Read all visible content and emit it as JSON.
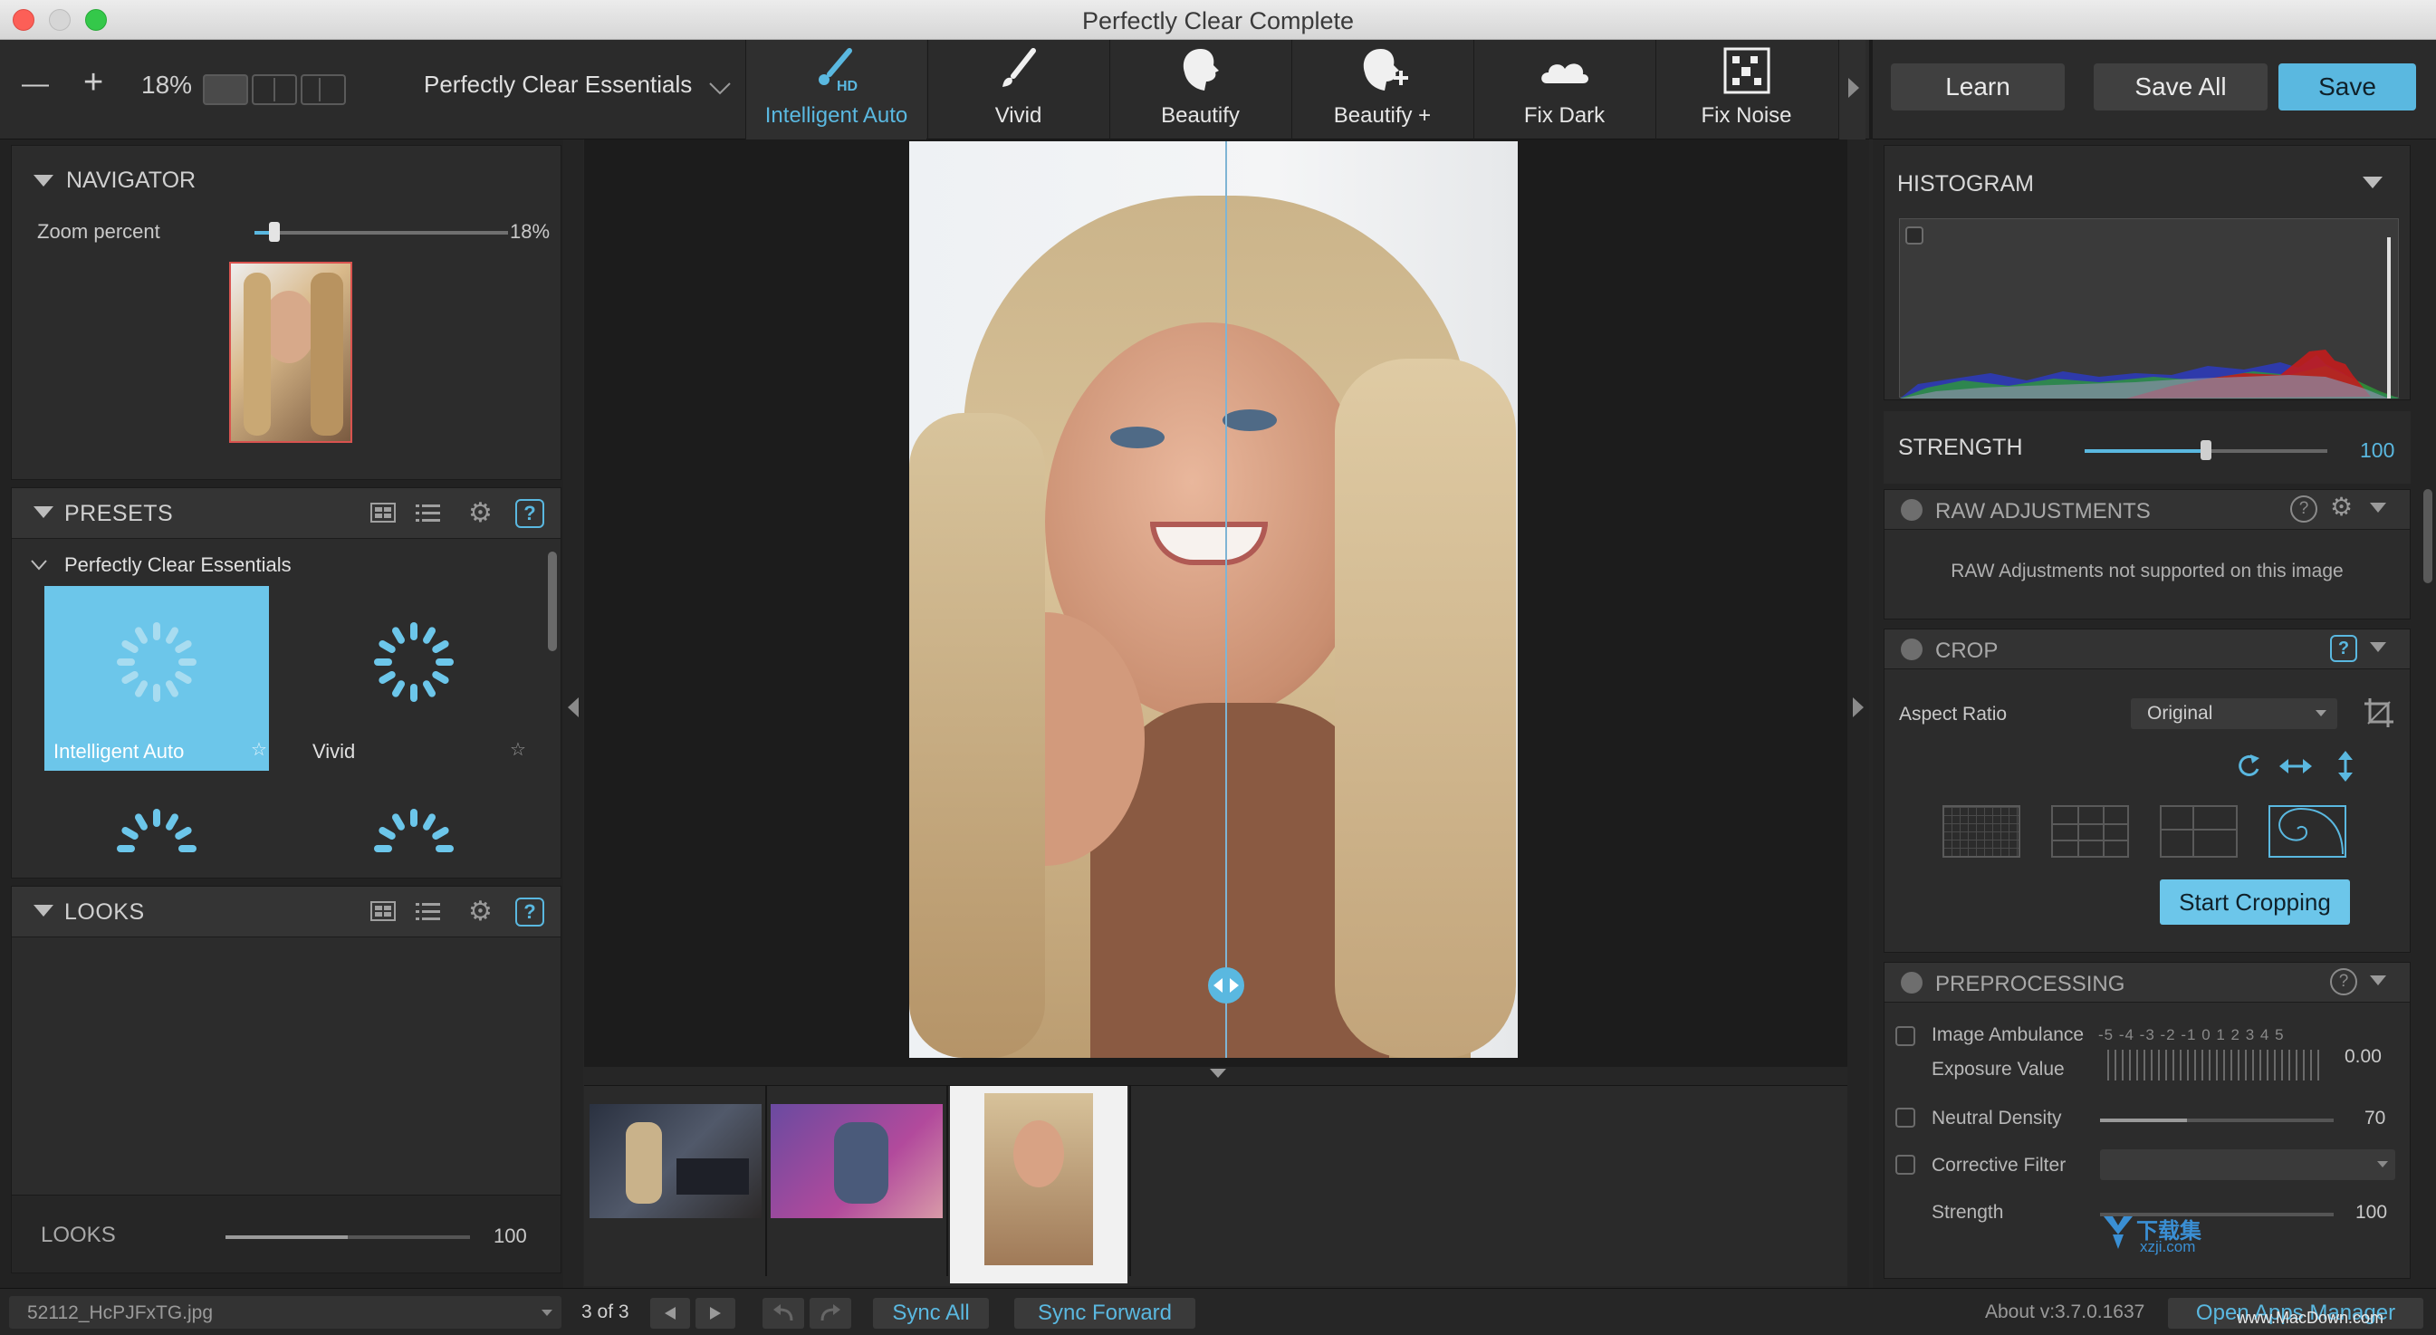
{
  "window": {
    "title": "Perfectly Clear Complete"
  },
  "toolbar": {
    "zoom_minus": "—",
    "zoom_plus": "+",
    "zoom_value": "18%",
    "preset_selector": "Perfectly Clear Essentials",
    "tools": [
      {
        "label": "Intelligent Auto",
        "badge": "HD",
        "active": true
      },
      {
        "label": "Vivid"
      },
      {
        "label": "Beautify"
      },
      {
        "label": "Beautify +"
      },
      {
        "label": "Fix Dark"
      },
      {
        "label": "Fix Noise"
      }
    ],
    "learn_label": "Learn",
    "save_all_label": "Save All",
    "save_label": "Save"
  },
  "navigator": {
    "title": "NAVIGATOR",
    "zoom_label": "Zoom percent",
    "zoom_value": "18%",
    "zoom_fraction": 0.08
  },
  "presets": {
    "title": "PRESETS",
    "group": "Perfectly Clear Essentials",
    "items": [
      {
        "label": "Intelligent Auto",
        "selected": true
      },
      {
        "label": "Vivid",
        "selected": false
      }
    ]
  },
  "looks": {
    "title": "LOOKS",
    "slider_label": "LOOKS",
    "slider_value": "100",
    "slider_fraction": 0.5
  },
  "histogram": {
    "title": "HISTOGRAM"
  },
  "strength": {
    "label": "STRENGTH",
    "value": "100",
    "fraction": 0.5
  },
  "raw": {
    "title": "RAW ADJUSTMENTS",
    "message": "RAW Adjustments not supported on this image"
  },
  "crop": {
    "title": "CROP",
    "aspect_label": "Aspect Ratio",
    "aspect_value": "Original",
    "start_label": "Start Cropping"
  },
  "preprocessing": {
    "title": "PREPROCESSING",
    "image_ambulance": "Image Ambulance",
    "exposure_label": "Exposure Value",
    "exposure_value": "0.00",
    "scale_text": "-5 -4 -3 -2 -1 0 1 2 3 4 5",
    "neutral_density": "Neutral Density",
    "neutral_value": "70",
    "neutral_fraction": 0.37,
    "corrective_filter": "Corrective Filter",
    "strength_label": "Strength",
    "strength_value": "100"
  },
  "bottom": {
    "filename": "52112_HcPJFxTG.jpg",
    "counter": "3 of 3",
    "sync_all": "Sync All",
    "sync_forward": "Sync Forward",
    "about": "About v:3.7.0.1637",
    "open_apps": "Open Apps Manager",
    "watermark_cn": "下载集",
    "watermark_url": "xzji.com",
    "watermark_mac": "www.MacDown.com"
  },
  "colors": {
    "accent": "#5ab8e0",
    "panel": "#2c2c2c",
    "header": "#343434"
  }
}
